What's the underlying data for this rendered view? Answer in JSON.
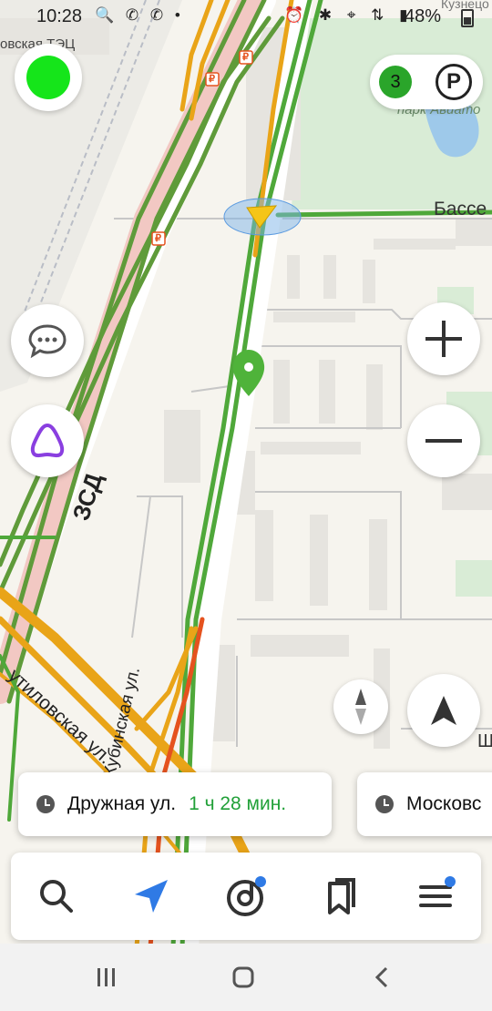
{
  "status_bar": {
    "time": "10:28",
    "left_icons": "🔍 ✆ ✆ •",
    "right_icons": "⏰ ✱ ⌖ ⇅ ▮",
    "battery": "48%"
  },
  "map": {
    "labels": {
      "tec": "овская ТЭЦ",
      "park": "парк Авиато",
      "kuznets": "Кузнецо",
      "basse": "Бассе",
      "zsd": "ЗСД",
      "putilovskaya": "утиловская ул.",
      "kubinskaya": "Кубинская ул.",
      "shch": "Щ"
    },
    "parking_marker": "₽"
  },
  "top_controls": {
    "traffic_score": "3",
    "parking_label": "P"
  },
  "route_cards": [
    {
      "destination": "Дружная ул.",
      "eta": "1 ч 28 мин."
    },
    {
      "destination": "Московс",
      "eta": ""
    }
  ],
  "colors": {
    "traffic_green": "#15e51a",
    "route_green": "#4fa83a",
    "route_orange": "#e9a418",
    "route_red": "#e5521e",
    "accent_blue": "#2f7ae5",
    "alice_purple": "#8a3fe0"
  },
  "bottom_tabs": [
    {
      "icon": "search-icon"
    },
    {
      "icon": "navigator-icon"
    },
    {
      "icon": "music-icon"
    },
    {
      "icon": "bookmarks-icon"
    },
    {
      "icon": "menu-icon"
    }
  ]
}
